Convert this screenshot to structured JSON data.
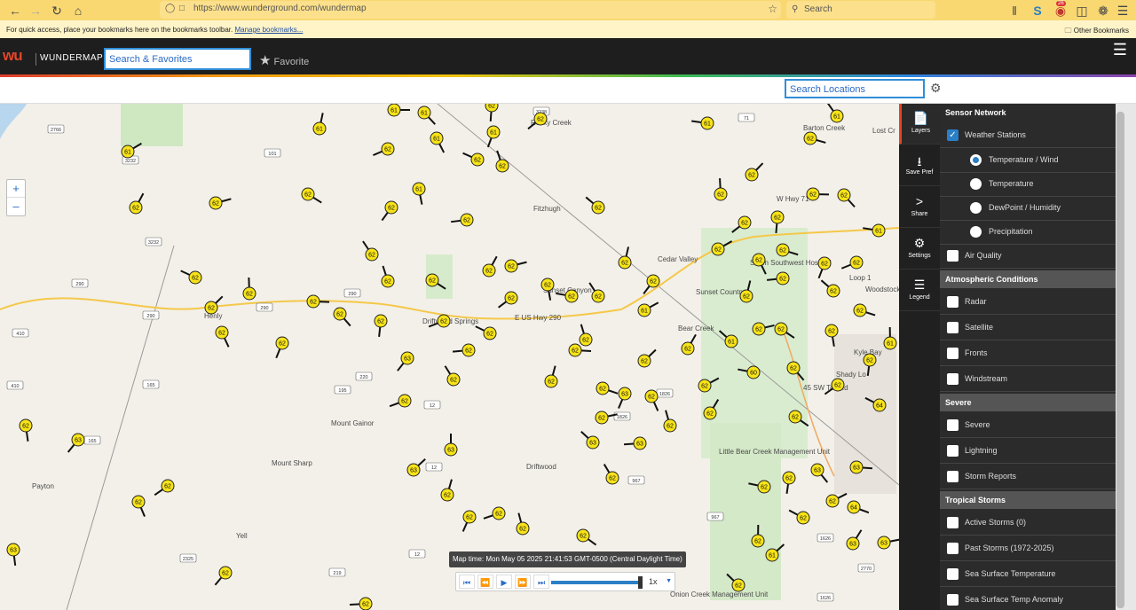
{
  "browser": {
    "url": "https://www.wunderground.com/wundermap",
    "url_domain": "wunderground.com",
    "search_placeholder": "Search",
    "bookmarks_message": "For quick access, place your bookmarks here on the bookmarks toolbar.",
    "manage_bookmarks": "Manage bookmarks...",
    "other_bookmarks": "Other Bookmarks",
    "notification_count": "26"
  },
  "header": {
    "logo": "wu",
    "brand": "WUNDERMAP",
    "search_placeholder": "Search & Favorites",
    "favorite_label": "Favorite"
  },
  "location_search": {
    "placeholder": "Search Locations"
  },
  "map": {
    "place_labels": [
      "Barton Creek",
      "Lost Cr",
      "Fitzhugh",
      "Cedar Valley",
      "Bear Creek",
      "Driftwood Springs",
      "Henly",
      "Mount Gainor",
      "Mount Sharp",
      "Driftwood",
      "Payton",
      "Yell",
      "Little Bear Creek Management Unit",
      "Onion Creek Management Unit",
      "Seton Southwest Hospital",
      "Loop 1",
      "E US Hwy 290",
      "W Hwy 71",
      "45 SW Toll Rd",
      "Shady Lo",
      "Woodstock Village",
      "Sunset Canyon",
      "Sunset Country",
      "Rocky Creek",
      "Kyle Bay"
    ],
    "route_shields": [
      "2766",
      "3232",
      "101",
      "3238",
      "71",
      "3232",
      "290",
      "290",
      "290",
      "290",
      "410",
      "165",
      "410",
      "220",
      "195",
      "12",
      "1826",
      "1826",
      "967",
      "967",
      "165",
      "12",
      "2325",
      "219",
      "12",
      "1626",
      "2770",
      "1626"
    ],
    "stations": [
      "61",
      "61",
      "62",
      "62",
      "61",
      "61",
      "61",
      "61",
      "62",
      "61",
      "61",
      "62",
      "62",
      "62",
      "62",
      "62",
      "62",
      "61",
      "62",
      "62",
      "62",
      "62",
      "62",
      "62",
      "62",
      "62",
      "62",
      "61",
      "62",
      "62",
      "62",
      "62",
      "62",
      "62",
      "62",
      "62",
      "62",
      "62",
      "62",
      "62",
      "62",
      "62",
      "62",
      "62",
      "62",
      "62",
      "62",
      "62",
      "62",
      "62",
      "62",
      "62",
      "62",
      "61",
      "62",
      "62",
      "62",
      "62",
      "62",
      "62",
      "62",
      "62",
      "62",
      "62",
      "63",
      "62",
      "61",
      "61",
      "62",
      "62",
      "62",
      "62",
      "62",
      "60",
      "62",
      "62",
      "62",
      "62",
      "62",
      "63",
      "62",
      "64",
      "62",
      "62",
      "62",
      "62",
      "62",
      "63",
      "63",
      "63",
      "63",
      "63",
      "63",
      "63",
      "62",
      "62",
      "62",
      "62",
      "62",
      "62",
      "64",
      "62",
      "62",
      "62",
      "62",
      "62",
      "63",
      "63",
      "62",
      "63",
      "62",
      "62",
      "62",
      "62",
      "61",
      "64"
    ],
    "zoom_in": "+",
    "zoom_out": "–",
    "map_time": "Map time: Mon May 05 2025 21:41:53 GMT-0500 (Central Daylight Time)",
    "playback_speed": "1x",
    "playback_progress": 1.0
  },
  "toolbar": [
    {
      "label": "Layers",
      "icon": "layers-icon"
    },
    {
      "label": "Save Pref",
      "icon": "download-icon"
    },
    {
      "label": "Share",
      "icon": "share-icon"
    },
    {
      "label": "Settings",
      "icon": "gear-icon"
    },
    {
      "label": "Legend",
      "icon": "list-icon"
    }
  ],
  "panel": {
    "sensor_network": "Sensor Network",
    "weather_stations": "Weather Stations",
    "ws_options": [
      "Temperature / Wind",
      "Temperature",
      "DewPoint / Humidity",
      "Precipitation"
    ],
    "air_quality": "Air Quality",
    "atmospheric": "Atmospheric Conditions",
    "atmospheric_items": [
      "Radar",
      "Satellite",
      "Fronts",
      "Windstream"
    ],
    "severe_head": "Severe",
    "severe_items": [
      "Severe",
      "Lightning",
      "Storm Reports"
    ],
    "tropical_head": "Tropical Storms",
    "tropical_items": [
      "Active Storms (0)",
      "Past Storms (1972-2025)",
      "Sea Surface Temperature",
      "Sea Surface Temp Anomaly"
    ]
  },
  "colors": {
    "accent": "#2a7fc7",
    "brand_red": "#e2462a",
    "station_yellow": "#f7e318",
    "header_bg": "#1e1e1f",
    "panel_bg": "#2b2b2c"
  }
}
